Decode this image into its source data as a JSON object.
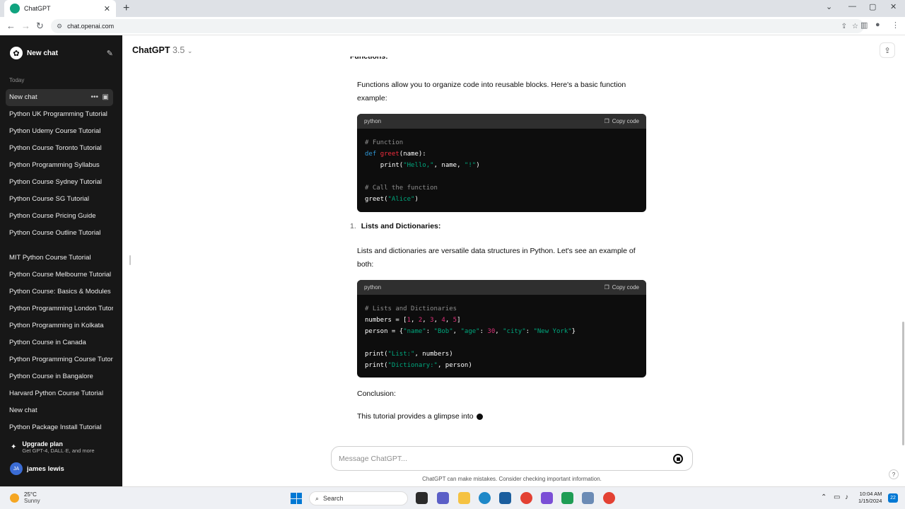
{
  "browser": {
    "tab_title": "ChatGPT",
    "url": "chat.openai.com"
  },
  "sidebar": {
    "new_chat_label": "New chat",
    "section_today": "Today",
    "items": [
      "New chat",
      "Python UK Programming Tutorial",
      "Python Udemy Course Tutorial",
      "Python Course Toronto Tutorial",
      "Python Programming Syllabus",
      "Python Course Sydney Tutorial",
      "Python Course SG Tutorial",
      "Python Course Pricing Guide",
      "Python Course Outline Tutorial"
    ],
    "items2": [
      "MIT Python Course Tutorial",
      "Python Course Melbourne Tutorial",
      "Python Course: Basics & Modules",
      "Python Programming London Tutorial",
      "Python Programming in Kolkata",
      "Python Course in Canada",
      "Python Programming Course Tutorial",
      "Python Course in Bangalore",
      "Harvard Python Course Tutorial",
      "New chat",
      "Python Package Install Tutorial"
    ],
    "upgrade_title": "Upgrade plan",
    "upgrade_sub": "Get GPT-4, DALL·E, and more",
    "user_initials": "JA",
    "user_name": "james lewis"
  },
  "header": {
    "model": "ChatGPT",
    "version": "3.5"
  },
  "conversation": {
    "cut_heading": "Functions:",
    "para1": "Functions allow you to organize code into reusable blocks. Here's a basic function example:",
    "code1_lang": "python",
    "copy_label": "Copy code",
    "list_number": "1.",
    "heading2": "Lists and Dictionaries:",
    "para2": "Lists and dictionaries are versatile data structures in Python. Let's see an example of both:",
    "code2_lang": "python",
    "conclusion": "Conclusion:",
    "para3": "This tutorial provides a glimpse into"
  },
  "composer": {
    "placeholder": "Message ChatGPT...",
    "disclaimer": "ChatGPT can make mistakes. Consider checking important information."
  },
  "taskbar": {
    "temp": "25°C",
    "weather": "Sunny",
    "search_label": "Search",
    "time": "10:04 AM",
    "date": "1/15/2024",
    "notif_count": "22"
  },
  "colors": {
    "sidebar_bg": "#171717",
    "code_bg": "#0d0d0d",
    "accent": "#10a37f"
  }
}
